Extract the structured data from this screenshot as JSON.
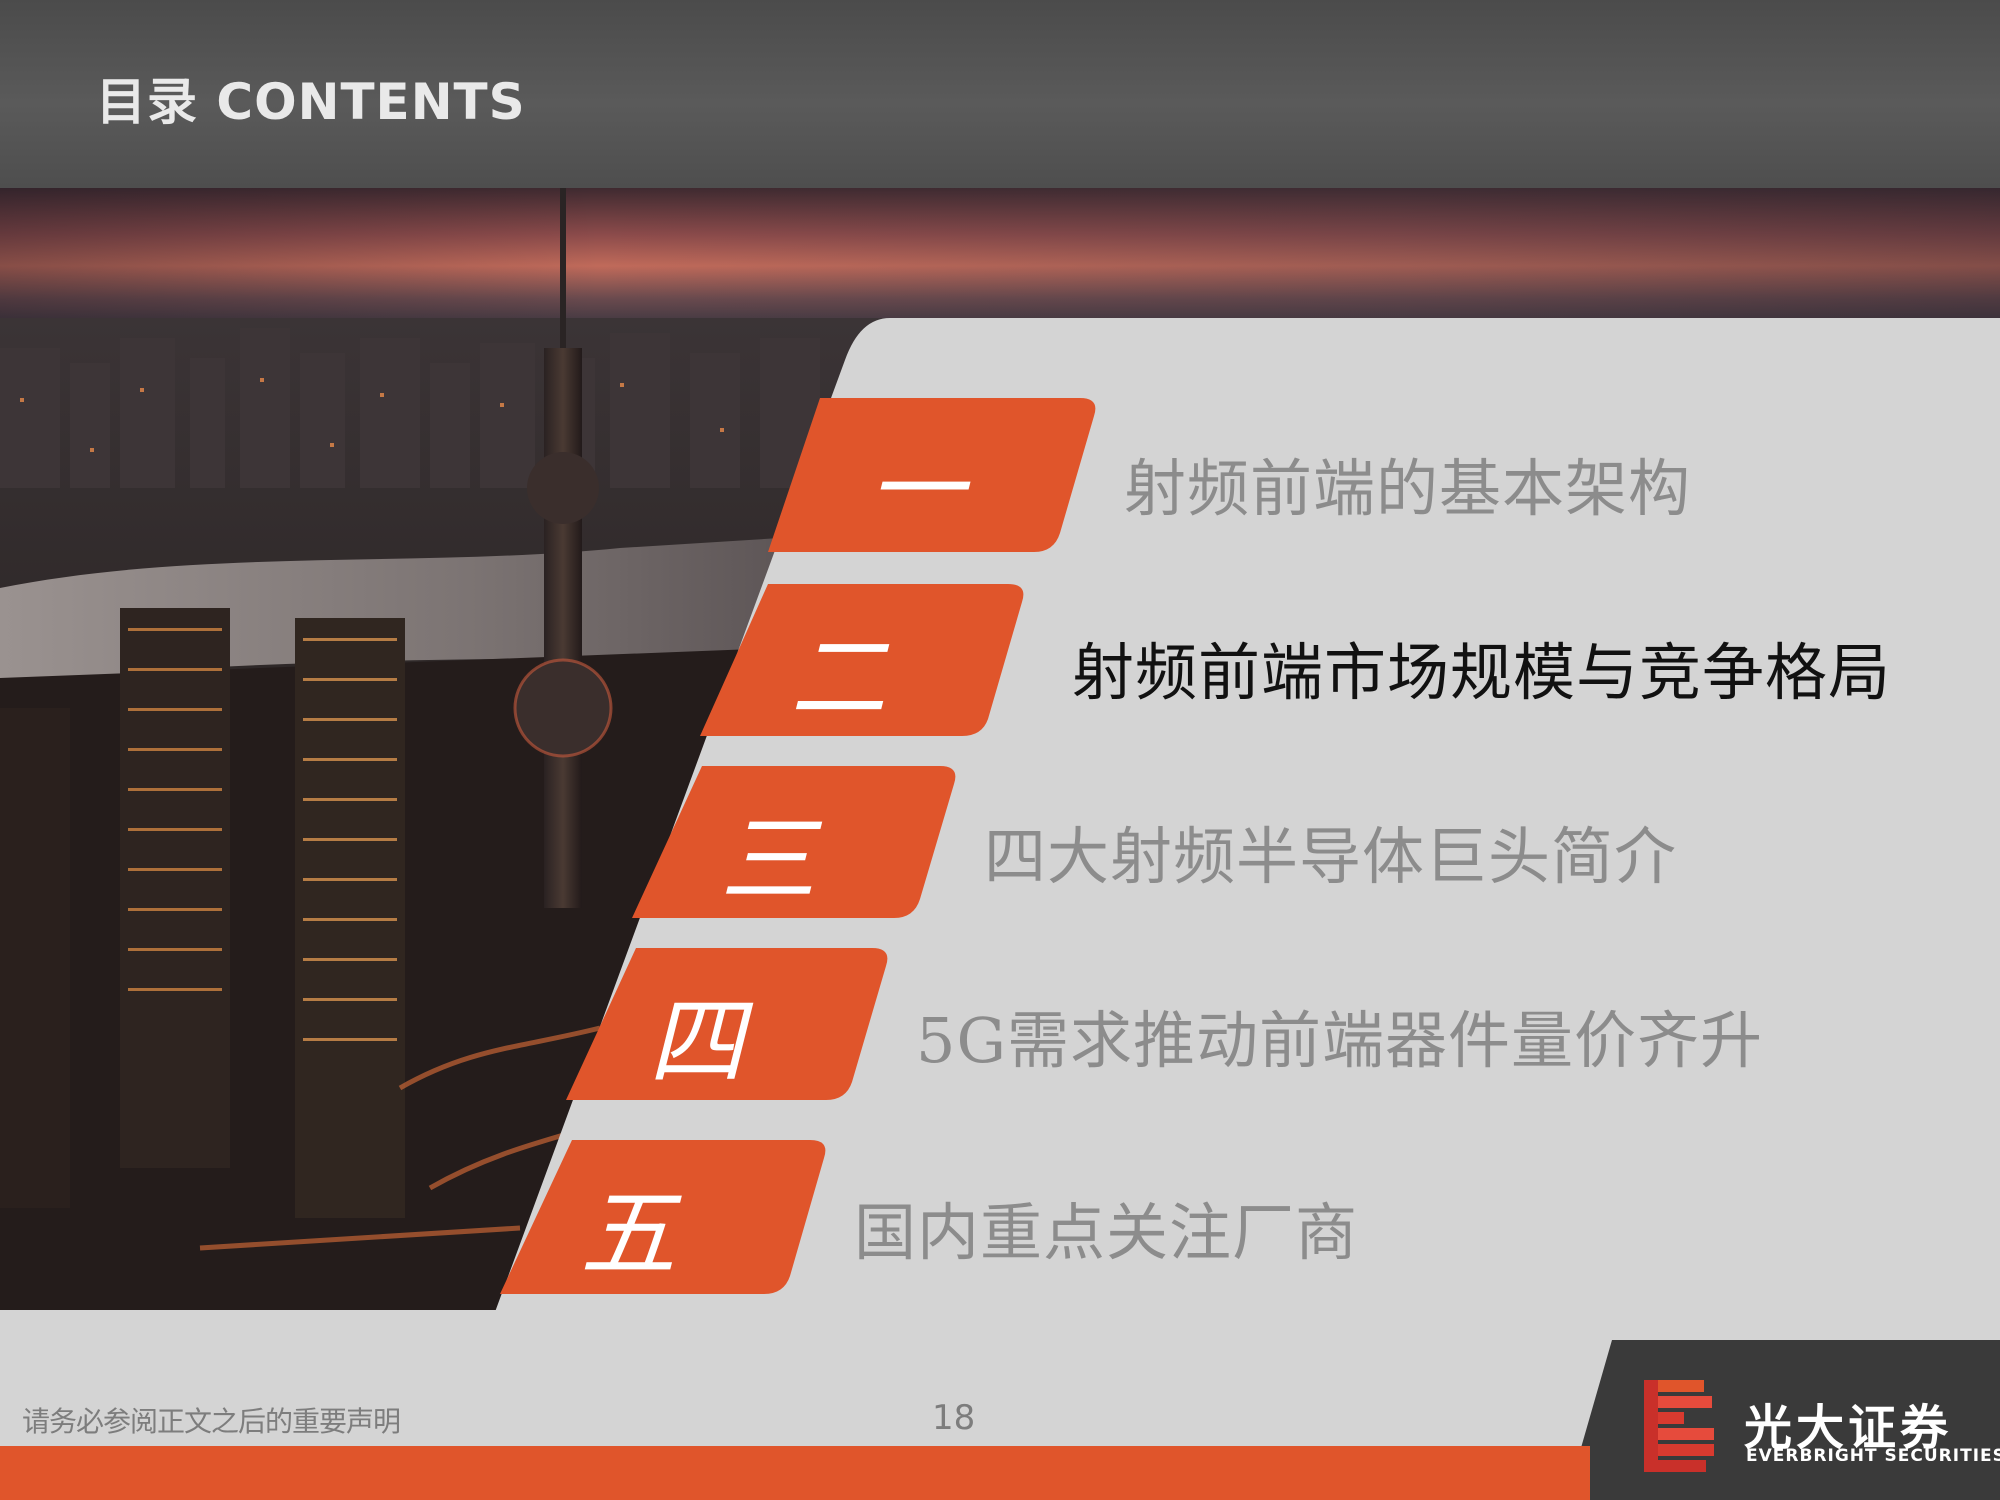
{
  "header": {
    "title": "目录   CONTENTS"
  },
  "menu": [
    {
      "numeral": "一",
      "label": "射频前端的基本架构",
      "active": false
    },
    {
      "numeral": "二",
      "label": "射频前端市场规模与竞争格局",
      "active": true
    },
    {
      "numeral": "三",
      "label": "四大射频半导体巨头简介",
      "active": false
    },
    {
      "numeral": "四",
      "label": "5G需求推动前端器件量价齐升",
      "active": false
    },
    {
      "numeral": "五",
      "label": "国内重点关注厂商",
      "active": false
    }
  ],
  "footer": {
    "disclaimer": "请务必参阅正文之后的重要声明",
    "page_number": "18"
  },
  "brand": {
    "name_cn": "光大证券",
    "name_en": "EVERBRIGHT SECURITIES"
  },
  "colors": {
    "accent": "#e0552b",
    "header": "#555555",
    "panel": "#d4d4d4"
  }
}
